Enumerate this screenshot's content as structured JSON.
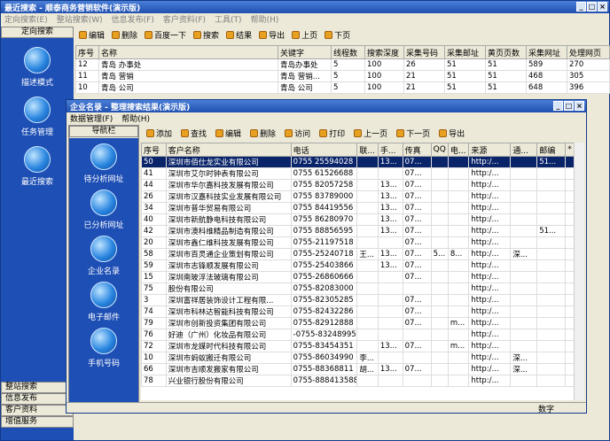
{
  "outer": {
    "title": "最近搜索 - 顺泰商务营销软件(演示版)",
    "menu": [
      "定向搜索(E)",
      "整站搜索(W)",
      "信息发布(F)",
      "客户资料(F)",
      "工具(T)",
      "帮助(H)"
    ],
    "toolbar": [
      "编辑",
      "删除",
      "百度一下",
      "搜索",
      "结果",
      "导出",
      "上页",
      "下页"
    ],
    "sidebar": {
      "head": "定向搜索",
      "items": [
        "描述模式",
        "任务管理",
        "最近搜索"
      ],
      "buttons": [
        "整站搜索",
        "信息发布",
        "客户资料",
        "增值服务"
      ]
    },
    "columns": [
      "序号",
      "名称",
      "关键字",
      "线程数",
      "搜索深度",
      "采集号码",
      "采集邮址",
      "黄页页数",
      "采集网址",
      "处理网页"
    ],
    "rows": [
      [
        "12",
        "青岛 办事处",
        "青岛办事处",
        "5",
        "100",
        "26",
        "51",
        "51",
        "589",
        "270"
      ],
      [
        "11",
        "青岛 营销",
        "青岛 营销...",
        "5",
        "100",
        "21",
        "51",
        "51",
        "468",
        "305"
      ],
      [
        "10",
        "青岛 公司",
        "青岛 公司",
        "5",
        "100",
        "21",
        "51",
        "51",
        "648",
        "396"
      ]
    ]
  },
  "inner": {
    "title": "企业名录 - 整理搜索结果(演示版)",
    "menu": [
      "数据管理(F)",
      "帮助(H)"
    ],
    "toolbar": [
      "添加",
      "查找",
      "编辑",
      "删除",
      "访问",
      "打印",
      "上一页",
      "下一页",
      "导出"
    ],
    "nav": {
      "head": "导航栏",
      "items": [
        "待分析网址",
        "已分析网址",
        "企业名录",
        "电子邮件",
        "手机号码"
      ]
    },
    "columns": [
      "序号",
      "客户名称",
      "电话",
      "联...",
      "手...",
      "传真",
      "QQ",
      "电...",
      "来源",
      "通...",
      "邮编",
      "*"
    ],
    "rows": [
      [
        "50",
        "深圳市佰仕龙实业有限公司",
        "0755 25594028",
        "",
        "13...",
        "07...",
        "",
        "",
        "http:/...",
        "",
        "51...",
        ""
      ],
      [
        "41",
        "深圳市艾尔时钟表有限公司",
        "0755 61526688",
        "",
        "",
        "07...",
        "",
        "",
        "http:/...",
        "",
        "",
        ""
      ],
      [
        "44",
        "深圳市华尔嘉科技发展有限公司",
        "0755 82057258",
        "",
        "13...",
        "07...",
        "",
        "",
        "http:/...",
        "",
        "",
        ""
      ],
      [
        "26",
        "深圳市汉嘉科技实业发展有限公司",
        "0755 83789000",
        "",
        "13...",
        "07...",
        "",
        "",
        "http:/...",
        "",
        "",
        ""
      ],
      [
        "34",
        "深圳市普华贸易有限公司",
        "0755 84419556",
        "",
        "13...",
        "07...",
        "",
        "",
        "http:/...",
        "",
        "",
        ""
      ],
      [
        "40",
        "深圳市新航静电科技有限公司",
        "0755 86280970",
        "",
        "13...",
        "07...",
        "",
        "",
        "http:/...",
        "",
        "",
        ""
      ],
      [
        "42",
        "深圳市澳科维精品制造有限公司",
        "0755 88856595",
        "",
        "13...",
        "07...",
        "",
        "",
        "http:/...",
        "",
        "51...",
        ""
      ],
      [
        "20",
        "深圳市鑫仁维科技发展有限公司",
        "0755-21197518",
        "",
        "",
        "07...",
        "",
        "",
        "http:/...",
        "",
        "",
        ""
      ],
      [
        "58",
        "深圳市百灵通企业策划有限公司",
        "0755-25240718",
        "王...",
        "13...",
        "07...",
        "5...",
        "8...",
        "http:/...",
        "深...",
        "",
        ""
      ],
      [
        "59",
        "深圳市志锋顺发展有限公司",
        "0755-25403866",
        "",
        "13...",
        "07...",
        "",
        "",
        "http:/...",
        "",
        "",
        ""
      ],
      [
        "15",
        "深圳南玻浮法玻璃有限公司",
        "0755-26860666",
        "",
        "",
        "07...",
        "",
        "",
        "http:/...",
        "",
        "",
        ""
      ],
      [
        "75",
        "股份有限公司",
        "0755-82083000",
        "",
        "",
        "",
        "",
        "",
        "http:/...",
        "",
        "",
        ""
      ],
      [
        "3",
        "深圳富祥居装饰设计工程有限...",
        "0755-82305285",
        "",
        "",
        "07...",
        "",
        "",
        "http:/...",
        "",
        "",
        ""
      ],
      [
        "74",
        "深圳市科林达智能科技有限公司",
        "0755-82432286",
        "",
        "",
        "07...",
        "",
        "",
        "http:/...",
        "",
        "",
        ""
      ],
      [
        "79",
        "深圳市创新投资集团有限公司",
        "0755-82912888",
        "",
        "",
        "07...",
        "",
        "m...",
        "http:/...",
        "",
        "",
        ""
      ],
      [
        "76",
        "好迪（广州）化妆品有限公司",
        "-0755-83248995",
        "",
        "",
        "",
        "",
        "",
        "http:/...",
        "",
        "",
        ""
      ],
      [
        "72",
        "深圳市龙媒时代科技有限公司",
        "0755-83454351",
        "",
        "13...",
        "07...",
        "",
        "m...",
        "http:/...",
        "",
        "",
        ""
      ],
      [
        "10",
        "深圳市蚂蚁搬迁有限公司",
        "0755-86034990",
        "李...",
        "",
        "",
        "",
        "",
        "http:/...",
        "深...",
        "",
        ""
      ],
      [
        "66",
        "深圳市吉顺发搬家有限公司",
        "0755-88368811",
        "胡...",
        "13...",
        "07...",
        "",
        "",
        "http:/...",
        "深...",
        "",
        ""
      ],
      [
        "78",
        "兴业银行股份有限公司",
        "0755-888413588",
        "",
        "",
        "",
        "",
        "",
        "http:/...",
        "",
        "",
        ""
      ]
    ],
    "status": "数字"
  }
}
